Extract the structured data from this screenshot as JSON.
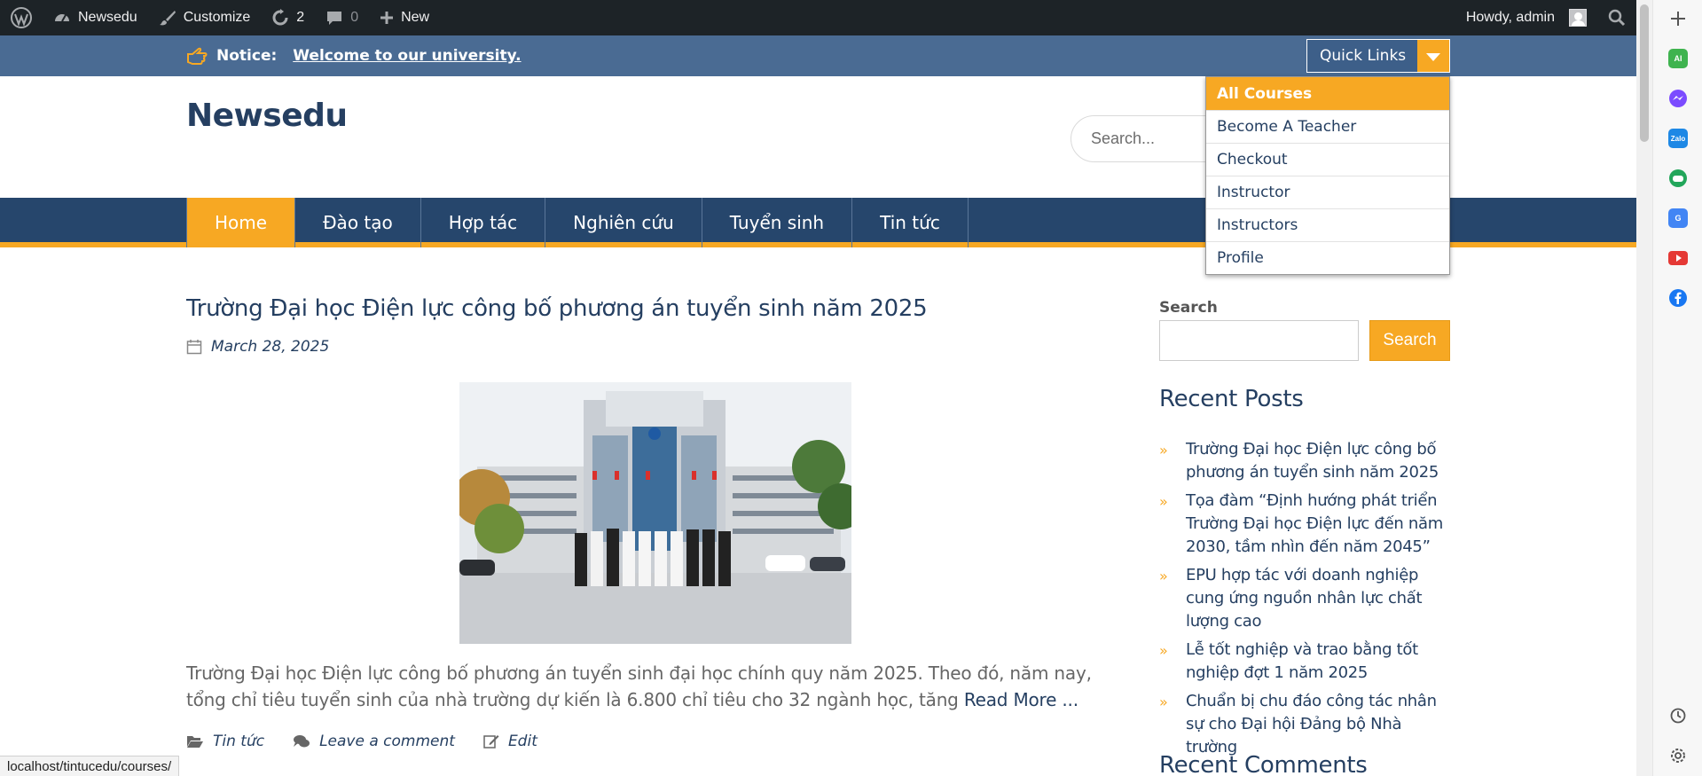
{
  "admin_bar": {
    "site_name": "Newsedu",
    "customize": "Customize",
    "updates_count": "2",
    "comments_count": "0",
    "new_label": "New",
    "greeting": "Howdy, admin"
  },
  "notice": {
    "label": "Notice:",
    "message": "Welcome to our university."
  },
  "quick_links": {
    "label": "Quick Links",
    "items": [
      "All Courses",
      "Become A Teacher",
      "Checkout",
      "Instructor",
      "Instructors",
      "Profile"
    ]
  },
  "site": {
    "title": "Newsedu",
    "search_placeholder": "Search..."
  },
  "nav": [
    "Home",
    "Đào tạo",
    "Hợp tác",
    "Nghiên cứu",
    "Tuyển sinh",
    "Tin tức"
  ],
  "post": {
    "title": "Trường Đại học Điện lực công bố phương án tuyển sinh năm 2025",
    "date": "March 28, 2025",
    "excerpt": "Trường Đại học Điện lực công bố phương án tuyển sinh đại học chính quy năm 2025. Theo đó, năm nay, tổng chỉ tiêu tuyển sinh của nhà trường dự kiến là 6.800 chỉ tiêu cho 32 ngành học, tăng ",
    "read_more": "Read More ...",
    "category": "Tin tức",
    "comment": "Leave a comment",
    "edit": "Edit"
  },
  "sidebar": {
    "search_label": "Search",
    "search_button": "Search",
    "recent_posts_title": "Recent Posts",
    "recent_posts": [
      "Trường Đại học Điện lực công bố phương án tuyển sinh năm 2025",
      "Tọa đàm “Định hướng phát triển Trường Đại học Điện lực đến năm 2030, tầm nhìn đến năm 2045”",
      "EPU hợp tác với doanh nghiệp cung ứng nguồn nhân lực chất lượng cao",
      "Lễ tốt nghiệp và trao bằng tốt nghiệp đợt 1 năm 2025",
      "Chuẩn bị chu đáo công tác nhân sự cho Đại hội Đảng bộ Nhà trường"
    ],
    "recent_comments_title": "Recent Comments"
  },
  "status_url": "localhost/tintucedu/courses/",
  "colors": {
    "admin_bar": "#1d2327",
    "notice_bar": "#4a6b93",
    "nav": "#26466c",
    "accent": "#f7a823",
    "title": "#253f61"
  },
  "side_panel_icons": [
    "plus-icon",
    "ai-icon",
    "messenger-icon",
    "zalo-icon",
    "game-icon",
    "translate-icon",
    "youtube-icon",
    "facebook-icon",
    "history-icon",
    "settings-icon"
  ]
}
